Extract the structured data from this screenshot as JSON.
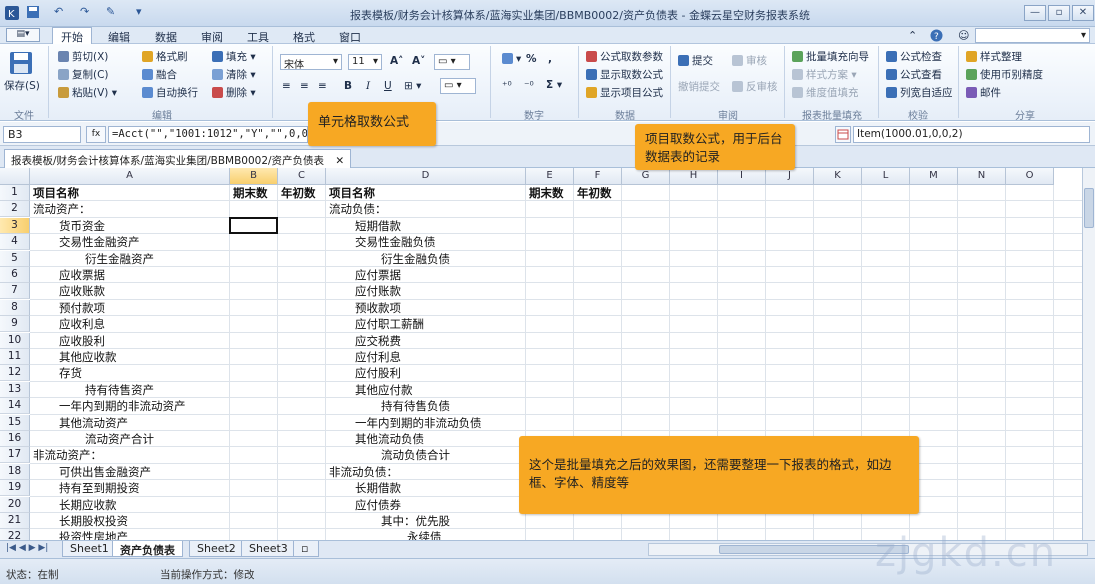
{
  "window": {
    "title": "报表模板/财务会计核算体系/蓝海实业集团/BBMB0002/资产负债表 - 金蝶云星空财务报表系统",
    "controls": [
      "—",
      "▫",
      "✕"
    ]
  },
  "menu": {
    "items": [
      "开始",
      "编辑",
      "数据",
      "审阅",
      "工具",
      "格式",
      "窗口"
    ],
    "active": "开始"
  },
  "ribbon": {
    "groups": {
      "file": "文件",
      "edit": "编辑",
      "number": "数字",
      "data": "数据",
      "review": "审阅",
      "batch": "报表批量填充",
      "check": "校验",
      "share": "分享"
    },
    "save": "保存(S)",
    "cut": "剪切(X)",
    "copy": "复制(C)",
    "paste": "粘贴(V)",
    "format_painter": "格式刷",
    "merge": "融合",
    "wrap": "自动换行",
    "fill": "填充",
    "clear": "清除",
    "delete": "删除",
    "font_name": "宋体",
    "font_size": "11",
    "formula_params": "公式取数参数",
    "show_formula": "显示取数公式",
    "show_item_formula": "显示项目公式",
    "submit": "提交",
    "unsubmit": "撤销提交",
    "audit": "审核",
    "unaudit": "反审核",
    "batch_fill_wizard": "批量填充向导",
    "style_scheme": "样式方案",
    "maintain_fill": "维度值填充",
    "formula_check": "公式检查",
    "formula_view": "公式查看",
    "col_autofit": "列宽自适应",
    "style_tidy": "样式整理",
    "currency_precision": "使用币别精度",
    "mail": "邮件"
  },
  "formula_bar": {
    "cell_ref": "B3",
    "fx_label": "fx",
    "formula": "=Acct(\"\",\"1001:1012\",\"Y\",\"\",0,0,0)",
    "item_formula": "Item(1000.01,0,0,2)"
  },
  "doc_tab": {
    "label": "报表模板/财务会计核算体系/蓝海实业集团/BBMB0002/资产负债表"
  },
  "grid": {
    "columns": [
      "A",
      "B",
      "C",
      "D",
      "E",
      "F",
      "G",
      "H",
      "I",
      "J",
      "K",
      "L",
      "M",
      "N",
      "O"
    ],
    "selected_column": "B",
    "selected_row": 3,
    "rows": [
      {
        "n": "1",
        "a": "项目名称",
        "b": "期末数",
        "c": "年初数",
        "d": "项目名称",
        "e": "期末数",
        "f": "年初数",
        "bold": true
      },
      {
        "n": "2",
        "a": "流动资产：",
        "d": "流动负债："
      },
      {
        "n": "3",
        "a": "货币资金",
        "a_indent": 1,
        "d": "短期借款",
        "d_indent": 1
      },
      {
        "n": "4",
        "a": "交易性金融资产",
        "a_indent": 1,
        "d": "交易性金融负债",
        "d_indent": 1
      },
      {
        "n": "5",
        "a": "衍生金融资产",
        "a_indent": 2,
        "d": "衍生金融负债",
        "d_indent": 2
      },
      {
        "n": "6",
        "a": "应收票据",
        "a_indent": 1,
        "d": "应付票据",
        "d_indent": 1
      },
      {
        "n": "7",
        "a": "应收账款",
        "a_indent": 1,
        "d": "应付账款",
        "d_indent": 1
      },
      {
        "n": "8",
        "a": "预付款项",
        "a_indent": 1,
        "d": "预收款项",
        "d_indent": 1
      },
      {
        "n": "9",
        "a": "应收利息",
        "a_indent": 1,
        "d": "应付职工薪酬",
        "d_indent": 1
      },
      {
        "n": "10",
        "a": "应收股利",
        "a_indent": 1,
        "d": "应交税费",
        "d_indent": 1
      },
      {
        "n": "11",
        "a": "其他应收款",
        "a_indent": 1,
        "d": "应付利息",
        "d_indent": 1
      },
      {
        "n": "12",
        "a": "存货",
        "a_indent": 1,
        "d": "应付股利",
        "d_indent": 1
      },
      {
        "n": "13",
        "a": "持有待售资产",
        "a_indent": 2,
        "d": "其他应付款",
        "d_indent": 1
      },
      {
        "n": "14",
        "a": "一年内到期的非流动资产",
        "a_indent": 1,
        "d": "持有待售负债",
        "d_indent": 2
      },
      {
        "n": "15",
        "a": "其他流动资产",
        "a_indent": 1,
        "d": "一年内到期的非流动负债",
        "d_indent": 1
      },
      {
        "n": "16",
        "a": "流动资产合计",
        "a_indent": 2,
        "d": "其他流动负债",
        "d_indent": 1
      },
      {
        "n": "17",
        "a": "非流动资产：",
        "d": "流动负债合计",
        "d_indent": 2
      },
      {
        "n": "18",
        "a": "可供出售金融资产",
        "a_indent": 1,
        "d": "非流动负债："
      },
      {
        "n": "19",
        "a": "持有至到期投资",
        "a_indent": 1,
        "d": "长期借款",
        "d_indent": 1
      },
      {
        "n": "20",
        "a": "长期应收款",
        "a_indent": 1,
        "d": "应付债券",
        "d_indent": 1
      },
      {
        "n": "21",
        "a": "长期股权投资",
        "a_indent": 1,
        "d": "其中：优先股",
        "d_indent": 2
      },
      {
        "n": "22",
        "a": "投资性房地产",
        "a_indent": 1,
        "d": "永续债",
        "d_indent": 3
      }
    ]
  },
  "sheets": [
    "Sheet1",
    "资产负债表",
    "Sheet2",
    "Sheet3"
  ],
  "active_sheet": "资产负债表",
  "status": {
    "state": "状态：在制",
    "mode": "当前操作方式：修改"
  },
  "callouts": {
    "cell_formula": "单元格取数公式",
    "item_formula": "项目取数公式，用于后台数据表的记录",
    "batch_fill": "这个是批量填充之后的效果图，还需要整理一下报表的格式，如边框、字体、精度等"
  },
  "watermark": "zjgkd.cn",
  "colors": {
    "accent": "#f7a823",
    "ribbon_bg": "#e6eef8",
    "selection_header": "#f8cf6e"
  }
}
